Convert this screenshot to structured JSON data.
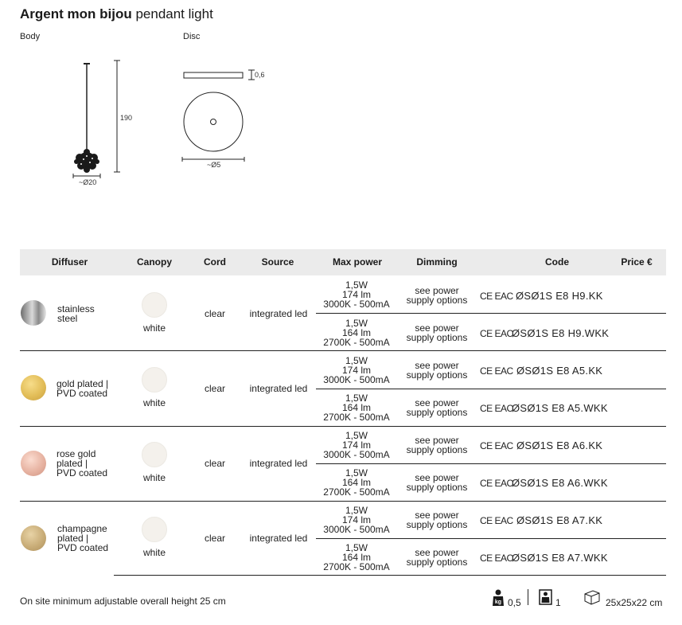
{
  "header": {
    "title_bold": "Argent mon bijou",
    "title_rest": "pendant light"
  },
  "drawings": {
    "body_label": "Body",
    "disc_label": "Disc",
    "body_height": "190",
    "body_diameter": "~Ø20",
    "disc_thickness": "0,6",
    "disc_diameter": "~Ø5"
  },
  "table": {
    "headers": {
      "diffuser": "Diffuser",
      "canopy": "Canopy",
      "cord": "Cord",
      "source": "Source",
      "max_power": "Max power",
      "dimming": "Dimming",
      "code": "Code",
      "price": "Price €"
    },
    "groups": [
      {
        "diffuser_lines": [
          "stainless",
          "steel"
        ],
        "swatch_color": "#a9a9a9",
        "canopy": "white",
        "cord": "clear",
        "source": "integrated led",
        "rows": [
          {
            "power": [
              "1,5W",
              "174 lm",
              "3000K - 500mA"
            ],
            "dimming": [
              "see power",
              "supply options"
            ],
            "cert": "CE EAC",
            "code": "ØSØ1S E8 H9.KK"
          },
          {
            "power": [
              "1,5W",
              "164 lm",
              "2700K - 500mA"
            ],
            "dimming": [
              "see power",
              "supply options"
            ],
            "cert": "CE EAC",
            "code": "ØSØ1S E8 H9.WKK"
          }
        ]
      },
      {
        "diffuser_lines": [
          "gold plated |",
          "PVD coated"
        ],
        "swatch_color": "#e2bd58",
        "canopy": "white",
        "cord": "clear",
        "source": "integrated led",
        "rows": [
          {
            "power": [
              "1,5W",
              "174 lm",
              "3000K - 500mA"
            ],
            "dimming": [
              "see power",
              "supply options"
            ],
            "cert": "CE EAC",
            "code": "ØSØ1S E8 A5.KK"
          },
          {
            "power": [
              "1,5W",
              "164 lm",
              "2700K - 500mA"
            ],
            "dimming": [
              "see power",
              "supply options"
            ],
            "cert": "CE EAC",
            "code": "ØSØ1S E8 A5.WKK"
          }
        ]
      },
      {
        "diffuser_lines": [
          "rose gold",
          "plated |",
          "PVD coated"
        ],
        "swatch_color": "#e7b3a2",
        "canopy": "white",
        "cord": "clear",
        "source": "integrated led",
        "rows": [
          {
            "power": [
              "1,5W",
              "174 lm",
              "3000K - 500mA"
            ],
            "dimming": [
              "see power",
              "supply options"
            ],
            "cert": "CE EAC",
            "code": "ØSØ1S E8 A6.KK"
          },
          {
            "power": [
              "1,5W",
              "164 lm",
              "2700K - 500mA"
            ],
            "dimming": [
              "see power",
              "supply options"
            ],
            "cert": "CE EAC",
            "code": "ØSØ1S E8 A6.WKK"
          }
        ]
      },
      {
        "diffuser_lines": [
          "champagne",
          "plated |",
          "PVD coated"
        ],
        "swatch_color": "#c9ad78",
        "canopy": "white",
        "cord": "clear",
        "source": "integrated led",
        "rows": [
          {
            "power": [
              "1,5W",
              "174 lm",
              "3000K - 500mA"
            ],
            "dimming": [
              "see power",
              "supply options"
            ],
            "cert": "CE EAC",
            "code": "ØSØ1S E8 A7.KK"
          },
          {
            "power": [
              "1,5W",
              "164 lm",
              "2700K - 500mA"
            ],
            "dimming": [
              "see power",
              "supply options"
            ],
            "cert": "CE EAC",
            "code": "ØSØ1S E8 A7.WKK"
          }
        ]
      }
    ]
  },
  "footer": {
    "note": "On site minimum adjustable overall height 25 cm",
    "weight_value": "0,5",
    "weight_icon": "kg-weight-icon",
    "pieces_value": "1",
    "pieces_icon": "box-count-icon",
    "package_size": "25x25x22 cm",
    "package_icon": "package-box-icon"
  }
}
